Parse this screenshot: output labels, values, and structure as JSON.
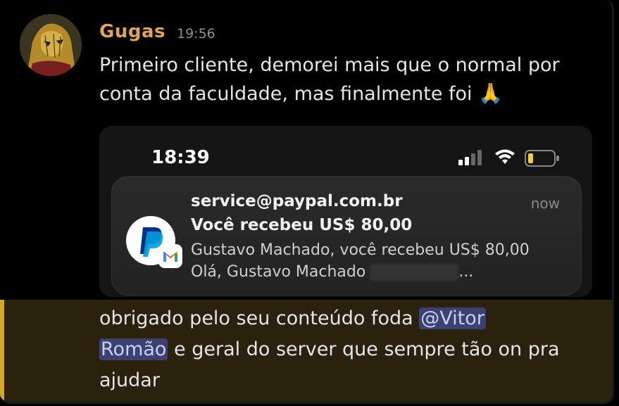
{
  "message": {
    "author": "Gugas",
    "timestamp": "19:56",
    "text": "Primeiro cliente, demorei mais que o normal por conta da faculdade, mas finalmente foi",
    "emoji": "🙏"
  },
  "attachment": {
    "status_time": "18:39",
    "notification": {
      "sender": "service@paypal.com.br",
      "time": "now",
      "title": "Você recebeu US$ 80,00",
      "body_before_redaction": "Gustavo Machado, você recebeu US$ 80,00 Olá, Gustavo Machado",
      "body_after_redaction": "...",
      "app_icon": "paypal-icon",
      "badge_icon": "gmail-icon"
    }
  },
  "followup": {
    "text_before": "obrigado pelo seu conteúdo foda",
    "mention_part1": "@Vitor",
    "mention_part2": "Romão",
    "text_after": "e geral do server que sempre tão on pra ajudar"
  },
  "colors": {
    "username": "#e0a35e",
    "highlight_bar": "#d4a72c",
    "mention_bg": "#3c4270"
  }
}
